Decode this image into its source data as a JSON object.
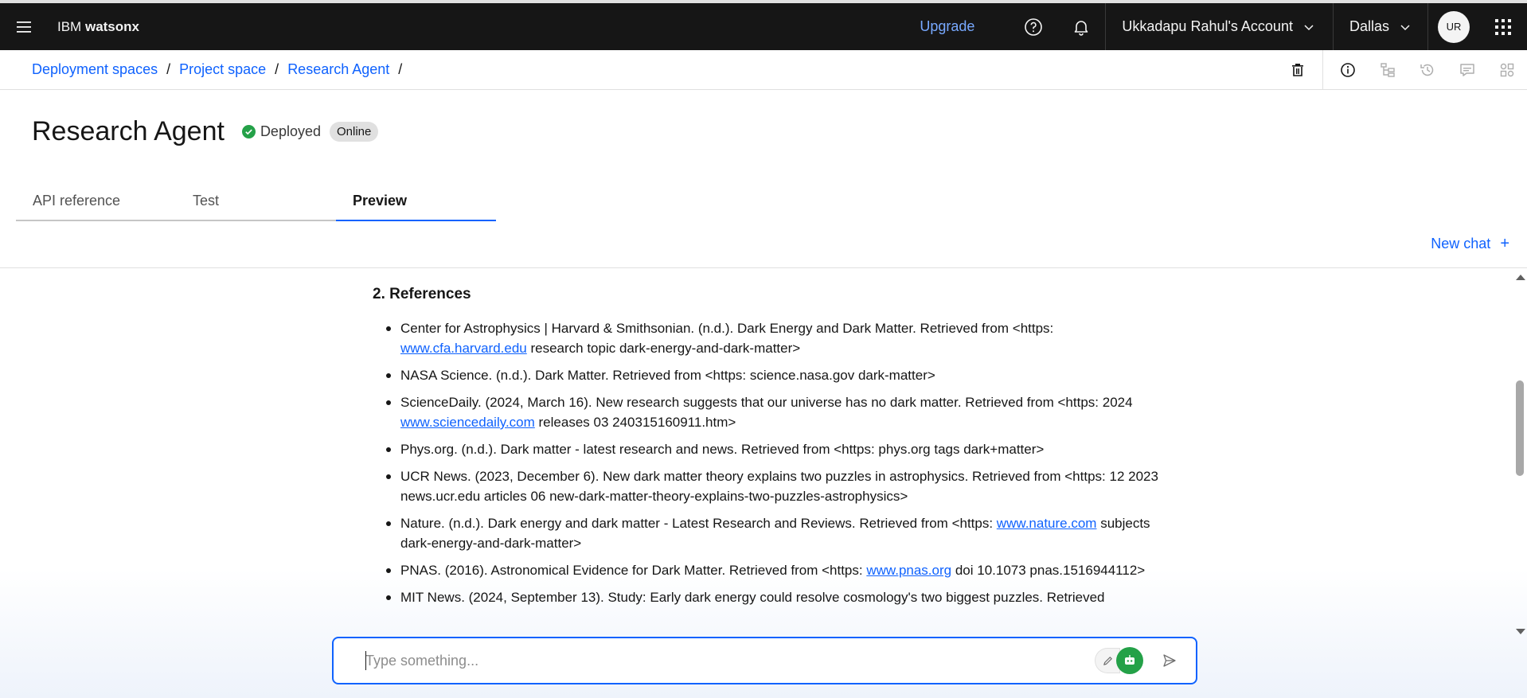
{
  "header": {
    "brand_prefix": "IBM",
    "brand_name": "watsonx",
    "upgrade": "Upgrade",
    "account": "Ukkadapu Rahul's Account",
    "region": "Dallas",
    "avatar_initials": "UR"
  },
  "breadcrumb": {
    "items": [
      "Deployment spaces",
      "Project space",
      "Research Agent"
    ],
    "separator": "/"
  },
  "page": {
    "title": "Research Agent",
    "status": "Deployed",
    "tag": "Online"
  },
  "tabs": [
    {
      "label": "API reference",
      "active": false
    },
    {
      "label": "Test",
      "active": false
    },
    {
      "label": "Preview",
      "active": true
    }
  ],
  "new_chat": "New chat",
  "chat": {
    "section_heading": "2. References",
    "references": [
      {
        "parts": [
          "Center for Astrophysics | Harvard & Smithsonian. (n.d.). Dark Energy and Dark Matter. Retrieved from <https: ",
          "www.cfa.harvard.edu",
          " research topic dark-energy-and-dark-matter>"
        ]
      },
      {
        "parts": [
          "NASA Science. (n.d.). Dark Matter. Retrieved from <https: science.nasa.gov dark-matter>",
          "",
          ""
        ]
      },
      {
        "parts": [
          "ScienceDaily. (2024, March 16). New research suggests that our universe has no dark matter. Retrieved from <https: 2024 ",
          "www.sciencedaily.com",
          " releases 03 240315160911.htm>"
        ]
      },
      {
        "parts": [
          "Phys.org. (n.d.). Dark matter - latest research and news. Retrieved from <https: phys.org tags dark+matter>",
          "",
          ""
        ]
      },
      {
        "parts": [
          "UCR News. (2023, December 6). New dark matter theory explains two puzzles in astrophysics. Retrieved from <https: 12 2023 news.ucr.edu articles 06 new-dark-matter-theory-explains-two-puzzles-astrophysics>",
          "",
          ""
        ]
      },
      {
        "parts": [
          "Nature. (n.d.). Dark energy and dark matter - Latest Research and Reviews. Retrieved from <https: ",
          "www.nature.com",
          " subjects dark-energy-and-dark-matter>"
        ]
      },
      {
        "parts": [
          "PNAS. (2016). Astronomical Evidence for Dark Matter. Retrieved from <https: ",
          "www.pnas.org",
          " doi 10.1073 pnas.1516944112>"
        ]
      },
      {
        "parts": [
          "MIT News. (2024, September 13). Study: Early dark energy could resolve cosmology's two biggest puzzles. Retrieved",
          "",
          ""
        ]
      }
    ]
  },
  "input": {
    "placeholder": "Type something...",
    "value": ""
  },
  "colors": {
    "header_bg": "#161616",
    "link": "#0f62fe",
    "upgrade": "#78a9ff",
    "status_green": "#24a148"
  },
  "icons": [
    "menu-icon",
    "help-icon",
    "notification-icon",
    "chevron-down-icon",
    "app-switcher-icon",
    "trash-icon",
    "info-icon",
    "hierarchy-icon",
    "history-icon",
    "comment-icon",
    "grid-icon",
    "checkmark-icon",
    "plus-icon",
    "edit-icon",
    "bot-icon",
    "send-icon"
  ]
}
